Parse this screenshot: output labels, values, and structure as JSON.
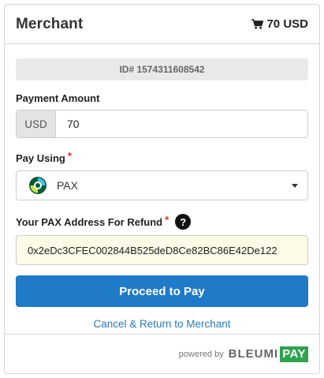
{
  "header": {
    "merchant_name": "Merchant",
    "cart_amount": "70 USD",
    "cart_icon": "shopping-cart-icon"
  },
  "order": {
    "id_label": "ID# 1574311608542"
  },
  "payment_amount": {
    "label": "Payment Amount",
    "currency": "USD",
    "value": "70"
  },
  "pay_using": {
    "label": "Pay Using",
    "required_mark": "*",
    "selected": "PAX",
    "coin_icon": "pax-coin-icon"
  },
  "address": {
    "label": "Your PAX Address For Refund",
    "required_mark": "*",
    "help_mark": "?",
    "value": "0x2eDc3CFEC002844B525deD8Ce82BC86E42De122"
  },
  "actions": {
    "proceed_label": "Proceed to Pay",
    "cancel_label": "Cancel & Return to Merchant"
  },
  "footer": {
    "powered_by": "powered by",
    "brand_primary": "BLEUMI",
    "brand_secondary": "PAY"
  },
  "colors": {
    "primary_button": "#1f7ac8",
    "link": "#2a7ab8",
    "required": "#d9302c",
    "brand_green": "#2fa24f",
    "address_bg": "#fbfbe8"
  }
}
